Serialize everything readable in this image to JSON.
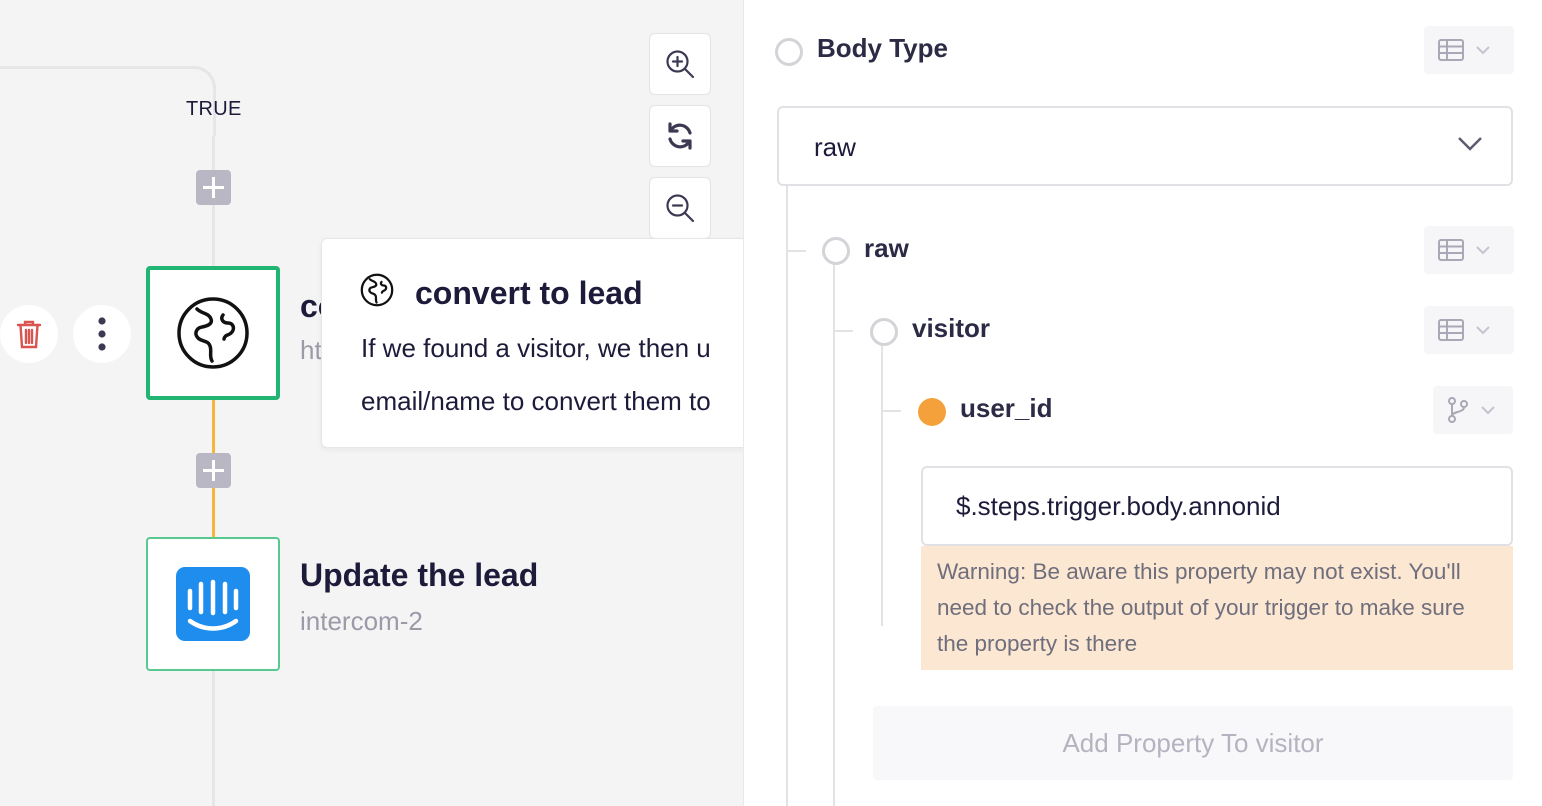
{
  "canvas": {
    "branch_label": "TRUE",
    "node_convert": {
      "title_partial": "co",
      "subtitle_partial": "ht"
    },
    "node_update": {
      "title": "Update the lead",
      "subtitle": "intercom-2"
    },
    "tooltip": {
      "title": "convert to lead",
      "line1": "If we found a visitor, we then u",
      "line2": "email/name to convert them to"
    },
    "colors": {
      "selected_border": "#21b573",
      "connector_orange": "#f5b73b",
      "intercom_blue": "#1f8ded",
      "delete_red": "#d9534f"
    }
  },
  "panel": {
    "body_type_label": "Body Type",
    "body_type_value": "raw",
    "tree": {
      "raw_label": "raw",
      "visitor_label": "visitor",
      "user_id_label": "user_id",
      "user_id_value": "$.steps.trigger.body.annonid"
    },
    "warning": "Warning: Be aware this property may not exist. You'll need to check the output of your trigger to make sure the property is there",
    "add_property_label": "Add Property To visitor",
    "colors": {
      "warning_bg": "#fbe7d2",
      "user_id_dot": "#f5a13b"
    }
  }
}
